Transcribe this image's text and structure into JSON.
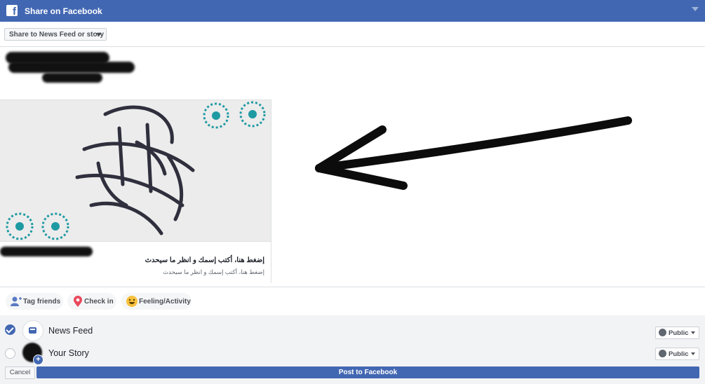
{
  "window": {
    "title": "Share on Facebook",
    "logo_glyph": "f",
    "brand_color": "#4267b2"
  },
  "share_target": {
    "selected": "Share to News Feed or story"
  },
  "card": {
    "title": "إضغط هنا، أكتب إسمك و انظر ما سيحدث",
    "description": "إضغط هنا، أكتب إسمك و انظر ما سيحدث"
  },
  "actions": {
    "tag_friends": "Tag friends",
    "check_in": "Check in",
    "feeling_activity": "Feeling/Activity"
  },
  "destinations": [
    {
      "label": "News Feed",
      "checked": true,
      "audience": "Public"
    },
    {
      "label": "Your Story",
      "checked": false,
      "audience": "Public"
    }
  ],
  "footer": {
    "cancel": "Cancel",
    "post": "Post to Facebook"
  }
}
